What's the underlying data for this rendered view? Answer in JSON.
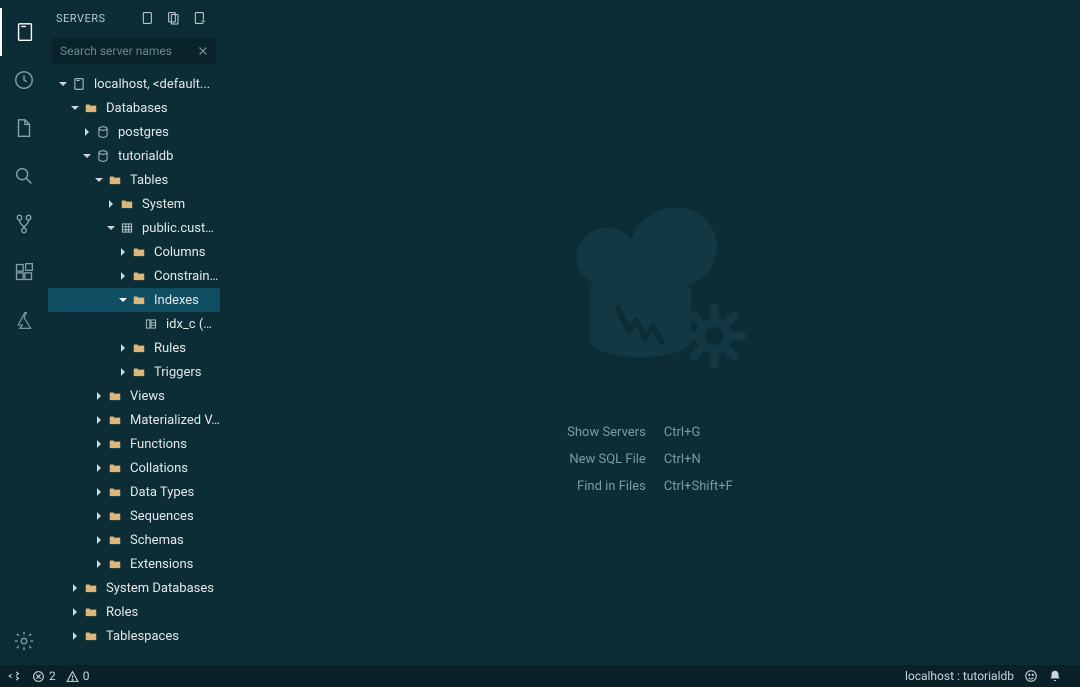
{
  "sidebar": {
    "title": "SERVERS",
    "search_placeholder": "Search server names"
  },
  "tree": {
    "server": "localhost, <default...",
    "databases": "Databases",
    "postgres": "postgres",
    "tutorialdb": "tutorialdb",
    "tables": "Tables",
    "system": "System",
    "public_customers": "public.custo...",
    "columns": "Columns",
    "constraints": "Constraints",
    "indexes": "Indexes",
    "idx_c": "idx_c (No...",
    "rules": "Rules",
    "triggers": "Triggers",
    "views": "Views",
    "materialized_views": "Materialized V...",
    "functions": "Functions",
    "collations": "Collations",
    "data_types": "Data Types",
    "sequences": "Sequences",
    "schemas": "Schemas",
    "extensions": "Extensions",
    "system_databases": "System Databases",
    "roles": "Roles",
    "tablespaces": "Tablespaces"
  },
  "welcome": {
    "show_servers_label": "Show Servers",
    "show_servers_key": "Ctrl+G",
    "new_sql_label": "New SQL File",
    "new_sql_key": "Ctrl+N",
    "find_label": "Find in Files",
    "find_key": "Ctrl+Shift+F"
  },
  "status": {
    "errors": "2",
    "warnings": "0",
    "connection": "localhost : tutorialdb"
  }
}
